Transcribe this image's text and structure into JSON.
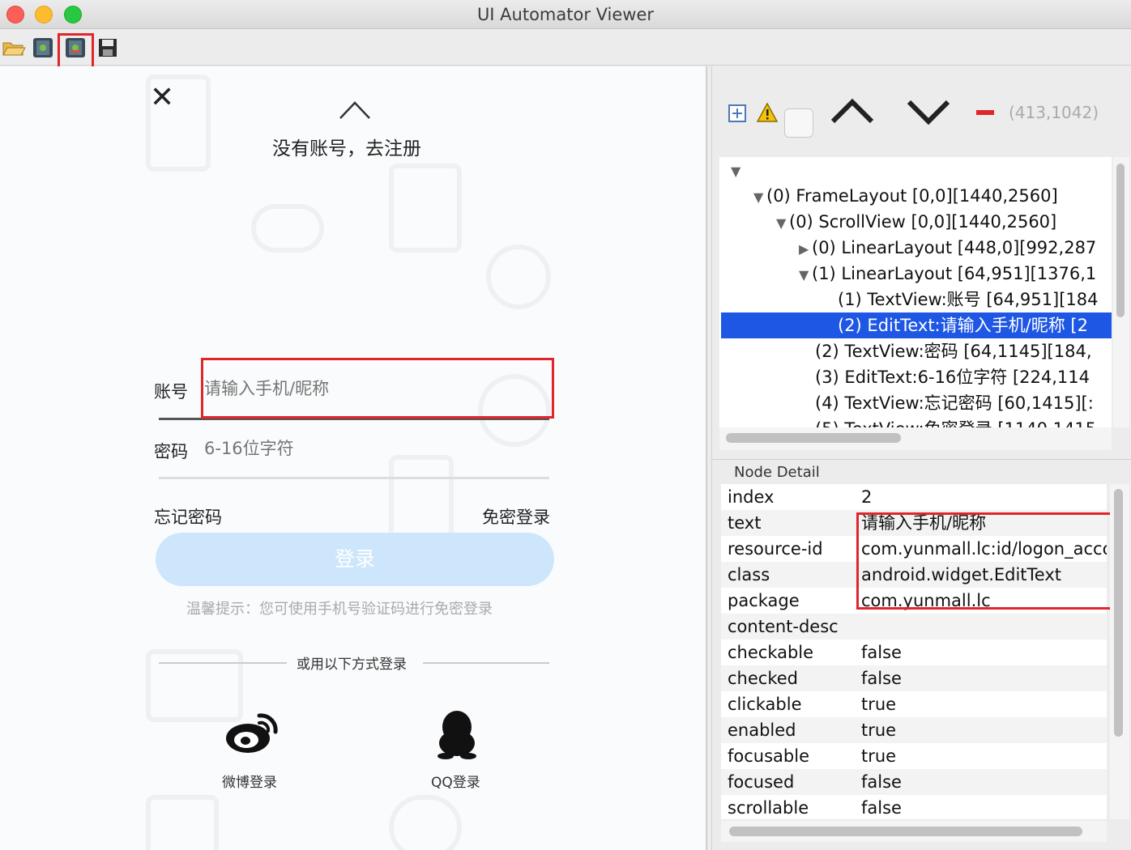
{
  "window": {
    "title": "UI Automator Viewer"
  },
  "device": {
    "register_link": "没有账号，去注册",
    "account_label": "账号",
    "account_placeholder": "请输入手机/昵称",
    "password_label": "密码",
    "password_placeholder": "6-16位字符",
    "forgot_password": "忘记密码",
    "no_password_login": "免密登录",
    "login_button": "登录",
    "hint": "温馨提示：您可使用手机号验证码进行免密登录",
    "or_divider": "或用以下方式登录",
    "weibo_label": "微博登录",
    "qq_label": "QQ登录"
  },
  "hierarchy": {
    "coords": "(413,1042)",
    "rows": [
      {
        "text": "(0) FrameLayout [0,0][1440,2560]"
      },
      {
        "text": "(0) ScrollView [0,0][1440,2560]"
      },
      {
        "text": "(0) LinearLayout [448,0][992,287"
      },
      {
        "text": "(1) LinearLayout [64,951][1376,1"
      },
      {
        "text": "(1) TextView:账号 [64,951][184"
      },
      {
        "text": "(2) EditText:请输入手机/昵称 [2"
      },
      {
        "text": "(2) TextView:密码 [64,1145][184,"
      },
      {
        "text": "(3) EditText:6-16位字符 [224,114"
      },
      {
        "text": "(4) TextView:忘记密码 [60,1415][:"
      },
      {
        "text": "(5) TextView:免密登录 [1140,1415"
      }
    ]
  },
  "node_detail": {
    "title": "Node Detail",
    "rows": [
      {
        "key": "index",
        "value": "2"
      },
      {
        "key": "text",
        "value": "请输入手机/昵称"
      },
      {
        "key": "resource-id",
        "value": "com.yunmall.lc:id/logon_acco"
      },
      {
        "key": "class",
        "value": "android.widget.EditText"
      },
      {
        "key": "package",
        "value": "com.yunmall.lc"
      },
      {
        "key": "content-desc",
        "value": ""
      },
      {
        "key": "checkable",
        "value": "false"
      },
      {
        "key": "checked",
        "value": "false"
      },
      {
        "key": "clickable",
        "value": "true"
      },
      {
        "key": "enabled",
        "value": "true"
      },
      {
        "key": "focusable",
        "value": "true"
      },
      {
        "key": "focused",
        "value": "false"
      },
      {
        "key": "scrollable",
        "value": "false"
      }
    ]
  },
  "colors": {
    "highlight": "#e0262b",
    "selection": "#1f57e5",
    "login_button": "#cde6fb"
  }
}
